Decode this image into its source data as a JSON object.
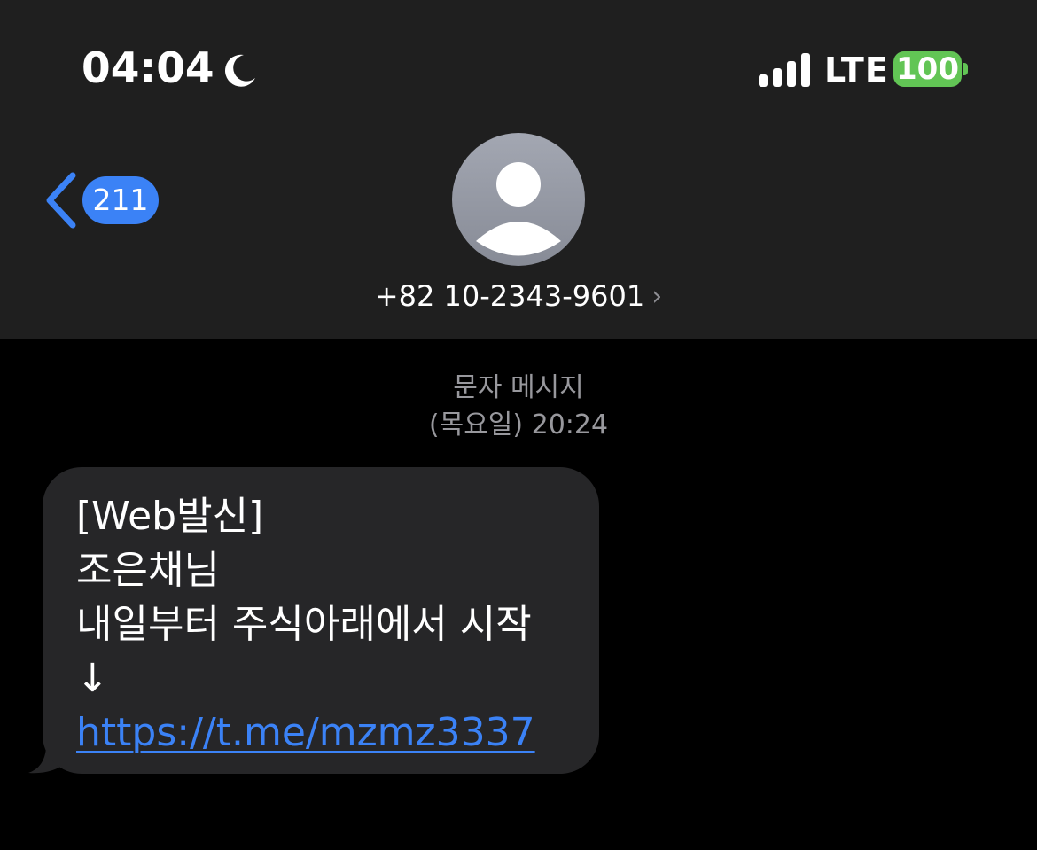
{
  "status_bar": {
    "time": "04:04",
    "moon_icon": "moon-icon",
    "signal_icon": "cellular-signal-icon",
    "network": "LTE",
    "battery": "100",
    "battery_color": "#62c555"
  },
  "nav": {
    "back_icon": "chevron-left-icon",
    "back_count": "211",
    "accent_color": "#3b82f6",
    "avatar_icon": "person-placeholder-icon",
    "contact": "+82 10-2343-9601",
    "contact_chevron": "›"
  },
  "conversation": {
    "message_type": "문자 메시지",
    "timestamp": "(목요일) 20:24",
    "messages": [
      {
        "direction": "incoming",
        "lines": [
          "[Web발신]",
          "조은채님",
          "내일부터 주식아래에서 시작",
          "↓"
        ],
        "link": "https://t.me/mzmz3337"
      }
    ]
  }
}
